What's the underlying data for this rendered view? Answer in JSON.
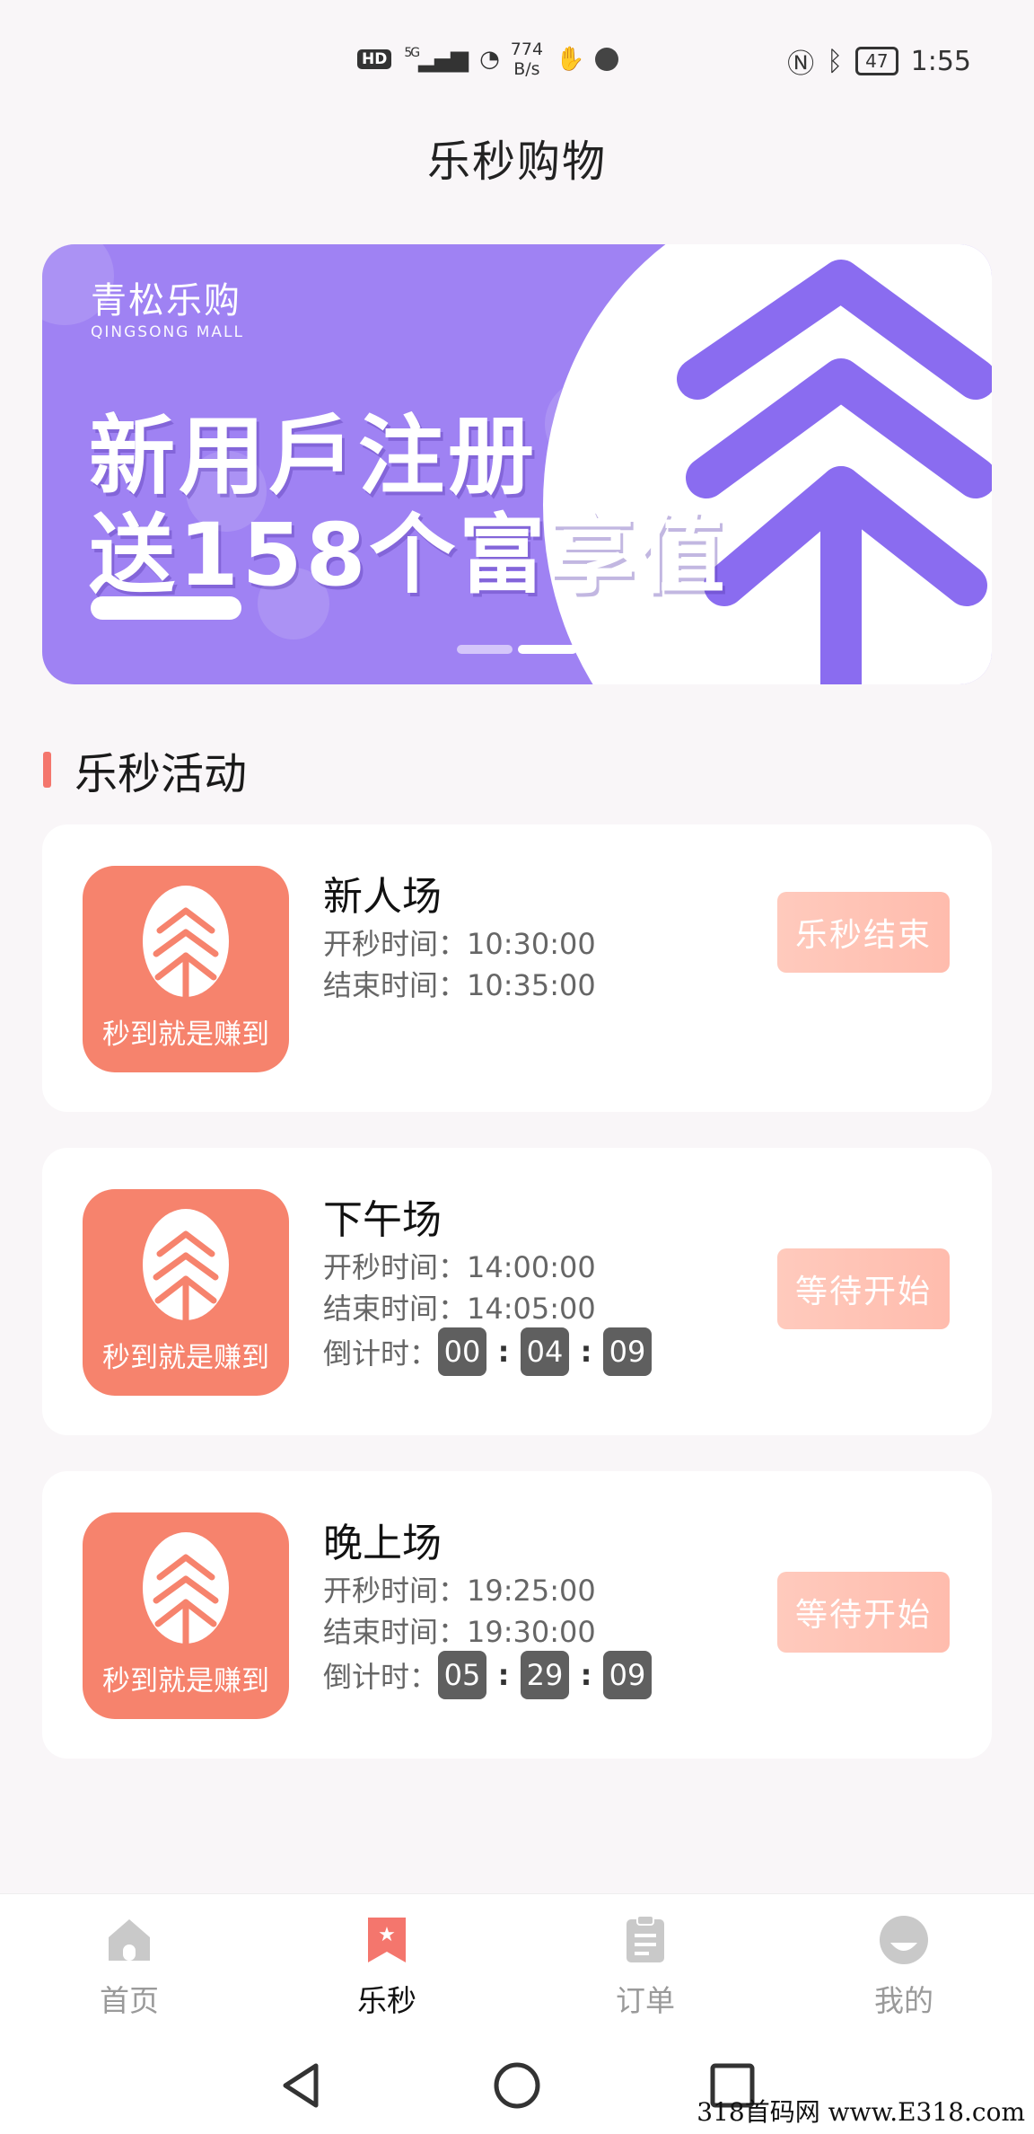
{
  "status_bar": {
    "hd": "HD",
    "signal": "5G",
    "net_rate_value": "774",
    "net_rate_unit": "B/s",
    "battery": "47",
    "time": "1:55"
  },
  "app_title": "乐秒购物",
  "banner": {
    "brand_name": "青松乐购",
    "brand_sub": "QINGSONG MALL",
    "line1": "新用戶注册",
    "line2": "送158个富享值",
    "bg_color": "#9f82f3"
  },
  "section": {
    "title": "乐秒活动",
    "accent": "#f4766d"
  },
  "logo_caption": "秒到就是赚到",
  "labels": {
    "start": "开秒时间：",
    "end": "结束时间：",
    "countdown": "倒计时："
  },
  "sessions": [
    {
      "name": "新人场",
      "start": "10:30:00",
      "end": "10:35:00",
      "button": "乐秒结束"
    },
    {
      "name": "下午场",
      "start": "14:00:00",
      "end": "14:05:00",
      "countdown": [
        "00",
        "04",
        "09"
      ],
      "button": "等待开始"
    },
    {
      "name": "晚上场",
      "start": "19:25:00",
      "end": "19:30:00",
      "countdown": [
        "05",
        "29",
        "09"
      ],
      "button": "等待开始"
    }
  ],
  "tabbar": [
    {
      "label": "首页",
      "icon": "home-icon"
    },
    {
      "label": "乐秒",
      "icon": "flash-sale-icon",
      "active": true
    },
    {
      "label": "订单",
      "icon": "order-icon"
    },
    {
      "label": "我的",
      "icon": "profile-icon"
    }
  ],
  "watermark": "318首码网 www.E318.com"
}
